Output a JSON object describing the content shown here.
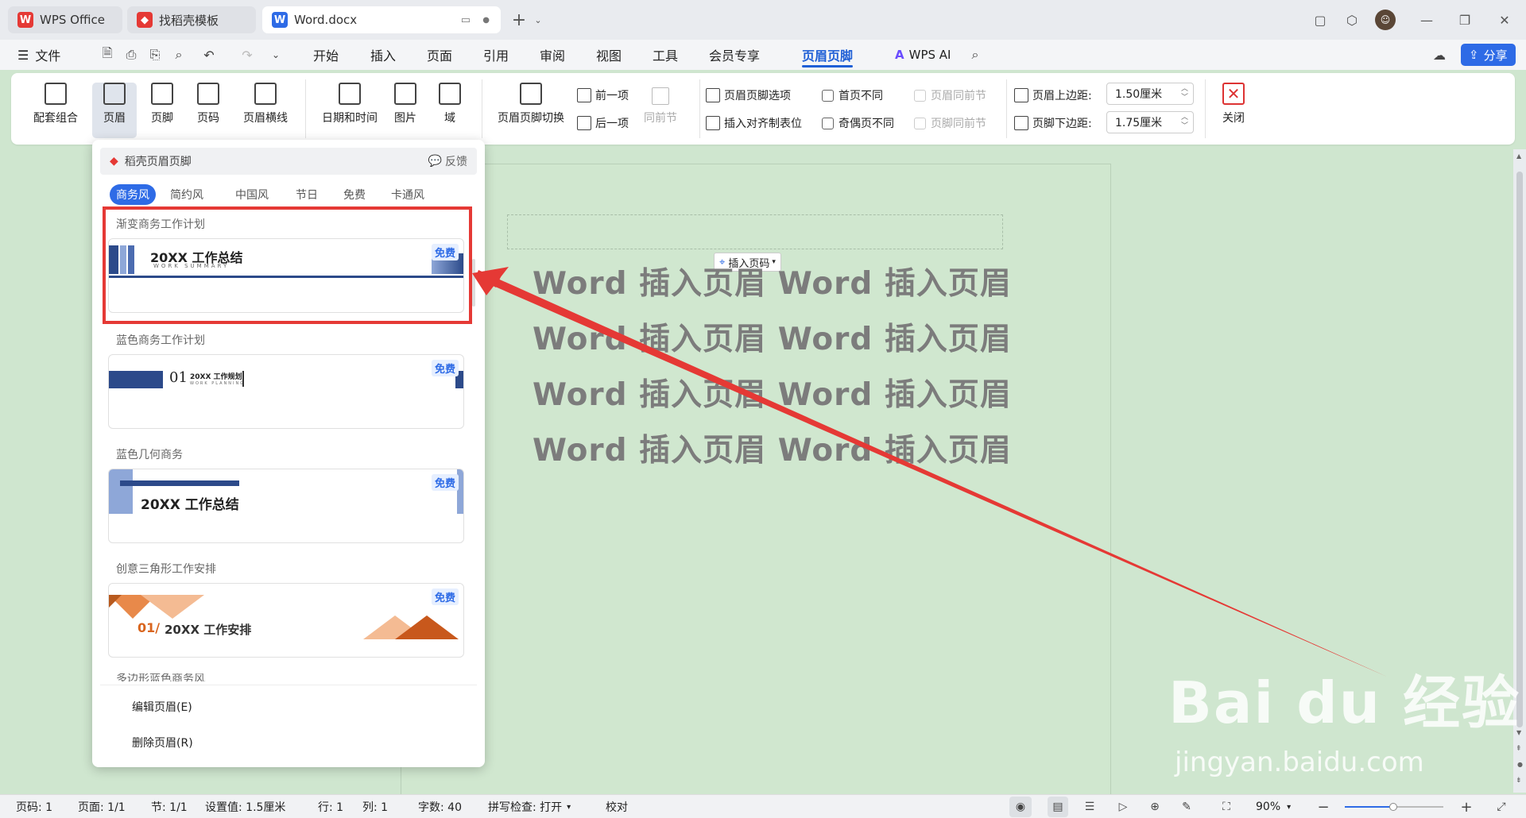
{
  "tabs": [
    {
      "label": "WPS Office"
    },
    {
      "label": "找稻壳模板"
    },
    {
      "label": "Word.docx"
    }
  ],
  "menu": {
    "file": "文件",
    "items": [
      "开始",
      "插入",
      "页面",
      "引用",
      "审阅",
      "视图",
      "工具",
      "会员专享",
      "页眉页脚"
    ],
    "active": "页眉页脚",
    "wps_ai": "WPS AI",
    "share": "分享"
  },
  "ribbon": {
    "peitao": "配套组合",
    "header": "页眉",
    "footer": "页脚",
    "pagenum": "页码",
    "headerline": "页眉横线",
    "datetime": "日期和时间",
    "picture": "图片",
    "field": "域",
    "switch": "页眉页脚切换",
    "prev": "前一项",
    "next": "后一项",
    "same_prev": "同前节",
    "options": "页眉页脚选项",
    "insert_tab": "插入对齐制表位",
    "first_diff": "首页不同",
    "odd_even": "奇偶页不同",
    "header_same": "页眉同前节",
    "footer_same": "页脚同前节",
    "top_margin_label": "页眉上边距:",
    "top_margin_value": "1.50厘米",
    "bottom_margin_label": "页脚下边距:",
    "bottom_margin_value": "1.75厘米",
    "close": "关闭"
  },
  "panel": {
    "title": "稻壳页眉页脚",
    "feedback": "反馈",
    "categories": [
      "商务风",
      "简约风",
      "中国风",
      "节日",
      "免费",
      "卡通风"
    ],
    "active_category": "商务风",
    "templates": [
      {
        "name": "渐变商务工作计划",
        "badge": "免费",
        "preview_title": "20XX 工作总结",
        "preview_sub": "WORK SUMMARY"
      },
      {
        "name": "蓝色商务工作计划",
        "badge": "免费",
        "preview_title": "20XX 工作规划",
        "preview_sub": "WORK PLANNING",
        "preview_num": "01"
      },
      {
        "name": "蓝色几何商务",
        "badge": "免费",
        "preview_title": "20XX 工作总结"
      },
      {
        "name": "创意三角形工作安排",
        "badge": "免费",
        "preview_title": "20XX 工作安排",
        "preview_num": "01/"
      },
      {
        "name": "多边形蓝色商务风"
      }
    ],
    "edit": "编辑页眉(E)",
    "delete": "删除页眉(R)"
  },
  "document": {
    "insert_pagenum": "插入页码",
    "lines": [
      "Word 插入页眉 Word 插入页眉",
      "Word 插入页眉 Word 插入页眉",
      "Word 插入页眉 Word 插入页眉",
      "Word 插入页眉 Word 插入页眉"
    ]
  },
  "status": {
    "page": "页码: 1",
    "pages": "页面: 1/1",
    "section": "节: 1/1",
    "setting": "设置值: 1.5厘米",
    "row": "行: 1",
    "col": "列: 1",
    "words": "字数: 40",
    "spell": "拼写检查: 打开",
    "proof": "校对",
    "zoom": "90%"
  },
  "watermark": {
    "brand": "Bai du 经验",
    "url": "jingyan.baidu.com"
  },
  "colors": {
    "accent": "#1f5fd6",
    "annotation": "#e53935",
    "doc_bg": "#cfe6cf"
  }
}
